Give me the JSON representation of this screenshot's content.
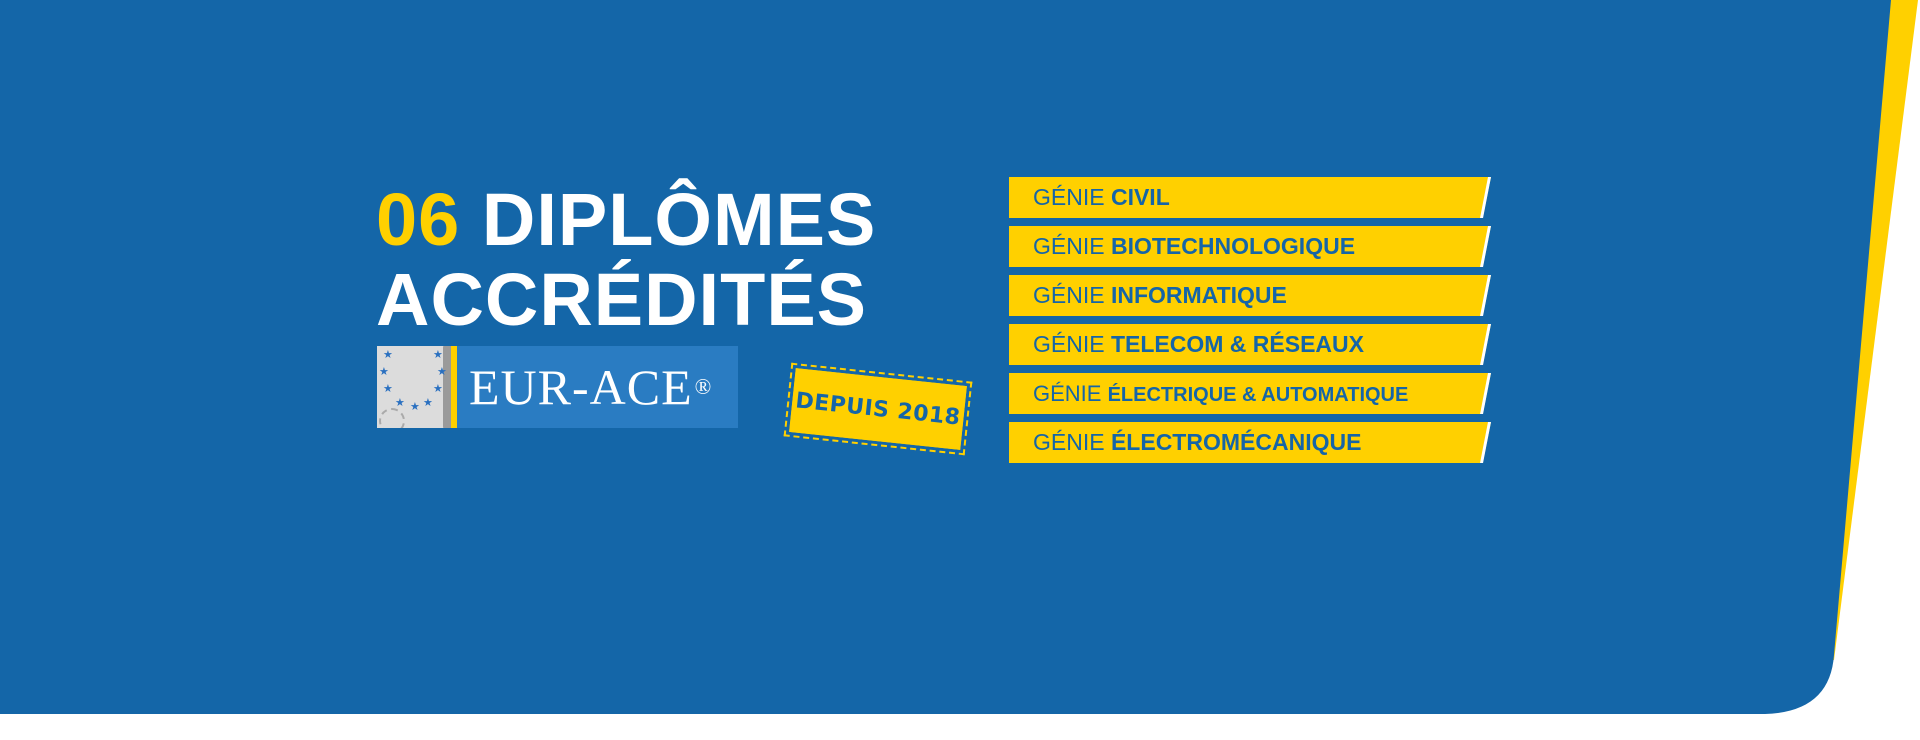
{
  "heading": {
    "number": "06",
    "line1": "DIPLÔMES",
    "line2": "ACCRÉDITÉS"
  },
  "logo": {
    "text": "EUR-ACE",
    "mark": "®"
  },
  "stamp": {
    "text": "DEPUIS 2018"
  },
  "programs": [
    {
      "prefix": "GÉNIE",
      "name": "CIVIL"
    },
    {
      "prefix": "GÉNIE",
      "name": "BIOTECHNOLOGIQUE"
    },
    {
      "prefix": "GÉNIE",
      "name": "INFORMATIQUE"
    },
    {
      "prefix": "GÉNIE",
      "name": "TELECOM & RÉSEAUX"
    },
    {
      "prefix": "GÉNIE",
      "name": "ÉLECTRIQUE & AUTOMATIQUE"
    },
    {
      "prefix": "GÉNIE",
      "name": "ÉLECTROMÉCANIQUE"
    }
  ],
  "colors": {
    "blue": "#1466a8",
    "yellow": "#ffd000",
    "logo_blue": "#2a7cc2"
  }
}
